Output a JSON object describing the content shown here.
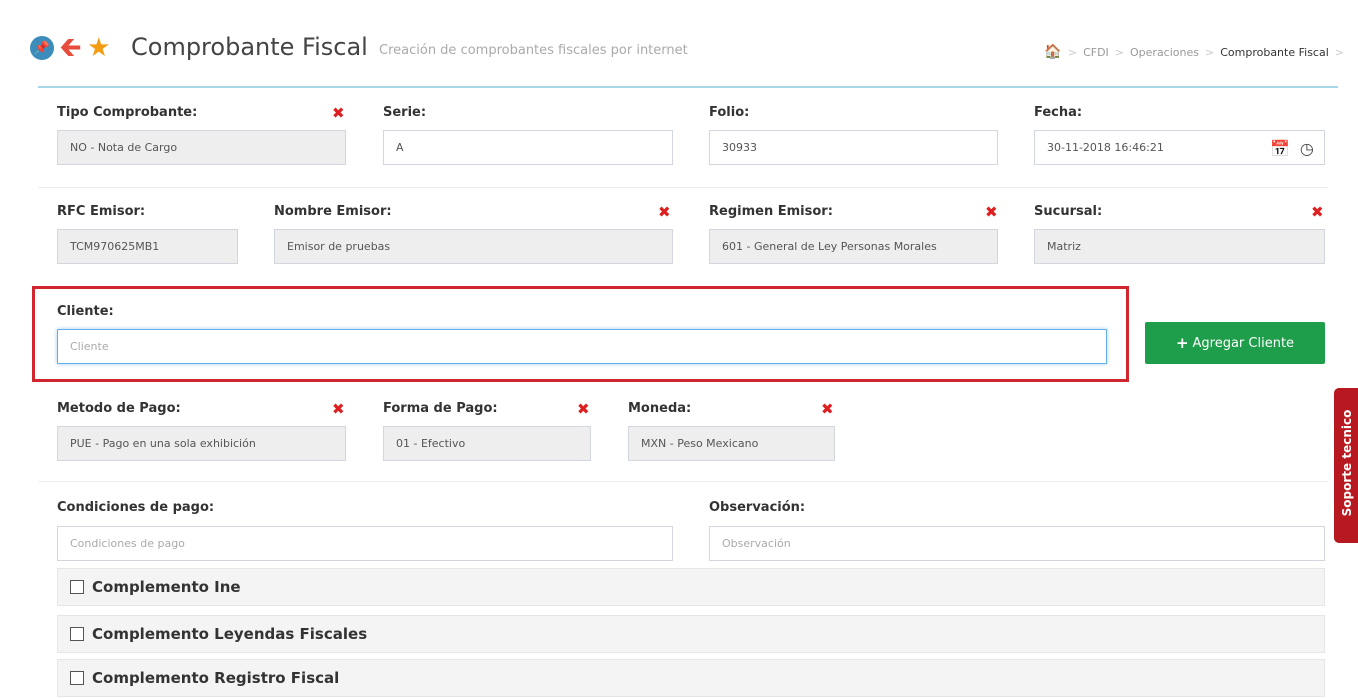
{
  "header": {
    "title": "Comprobante Fiscal",
    "subtitle": "Creación de comprobantes fiscales por internet",
    "icons": [
      "pin-icon",
      "back-arrow-icon",
      "star-icon"
    ]
  },
  "breadcrumb": [
    "CFDI",
    "Operaciones",
    "Comprobante Fiscal"
  ],
  "row1": {
    "tipo_label": "Tipo Comprobante:",
    "tipo_value": "NO - Nota de Cargo",
    "serie_label": "Serie:",
    "serie_value": "A",
    "folio_label": "Folio:",
    "folio_value": "30933",
    "fecha_label": "Fecha:",
    "fecha_value": "30-11-2018 16:46:21"
  },
  "row2": {
    "rfc_label": "RFC Emisor:",
    "rfc_value": "TCM970625MB1",
    "nombre_label": "Nombre Emisor:",
    "nombre_value": "Emisor de pruebas",
    "regimen_label": "Regimen Emisor:",
    "regimen_value": "601 - General de Ley Personas Morales",
    "sucursal_label": "Sucursal:",
    "sucursal_value": "Matriz"
  },
  "cliente": {
    "label": "Cliente:",
    "placeholder": "Cliente",
    "add_button": "Agregar Cliente"
  },
  "row4": {
    "metodo_label": "Metodo de Pago:",
    "metodo_value": "PUE - Pago en una sola exhibición",
    "forma_label": "Forma de Pago:",
    "forma_value": "01 - Efectivo",
    "moneda_label": "Moneda:",
    "moneda_value": "MXN - Peso Mexicano"
  },
  "row5": {
    "condiciones_label": "Condiciones de pago:",
    "condiciones_placeholder": "Condiciones de pago",
    "observacion_label": "Observación:",
    "observacion_placeholder": "Observación"
  },
  "complementos": [
    "Complemento Ine",
    "Complemento Leyendas Fiscales",
    "Complemento Registro Fiscal"
  ],
  "soporte": "Soporte tecnico",
  "colors": {
    "accent": "#3c8dbc",
    "success": "#1e9e4a",
    "danger": "#dd1f1f",
    "highlight": "#d0262d",
    "soporte": "#b8181f"
  }
}
